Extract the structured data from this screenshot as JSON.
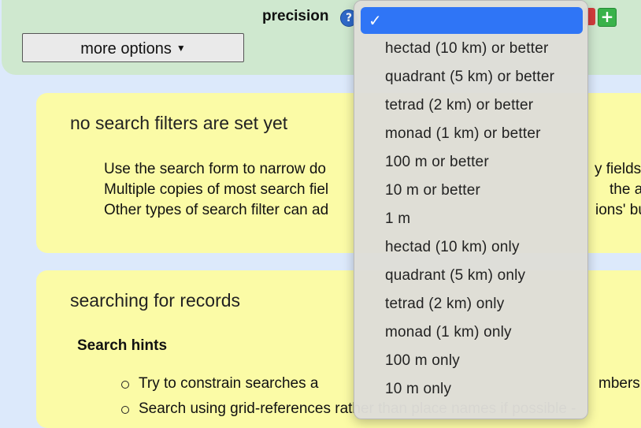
{
  "header": {
    "precision_label": "precision",
    "help_glyph": "?",
    "add_glyph": "+",
    "more_options_label": "more options",
    "more_options_caret": "▼"
  },
  "filters_box": {
    "title": "no search filters are set yet",
    "lines": [
      "Use the search form to narrow do",
      "Multiple copies of most search fiel",
      "Other types of search filter can ad"
    ],
    "right_fragments": [
      "y fields",
      "the adja",
      "ions' bu"
    ]
  },
  "records_box": {
    "title": "searching for records",
    "hints_heading": "Search hints",
    "bullets": [
      "Try to constrain searches a",
      "Search using grid-references rather than place names if possible -"
    ],
    "right_fragment": "mbers c"
  },
  "dropdown": {
    "selected_mark": "✓",
    "options": [
      "hectad (10 km) or better",
      "quadrant (5 km) or better",
      "tetrad (2 km) or better",
      "monad (1 km) or better",
      "100 m or better",
      "10 m or better",
      "1 m",
      "hectad (10 km) only",
      "quadrant (5 km) only",
      "tetrad (2 km) only",
      "monad (1 km) only",
      "100 m only",
      "10 m only"
    ]
  },
  "colors": {
    "selection": "#2f75f6",
    "panel_green": "#cfe8cf",
    "box_yellow": "#fbfba6",
    "page_blue": "#dce9fb"
  },
  "icons": [
    "help-icon",
    "remove-icon",
    "add-icon",
    "caret-down-icon",
    "checkmark-icon",
    "bullet-icon"
  ]
}
